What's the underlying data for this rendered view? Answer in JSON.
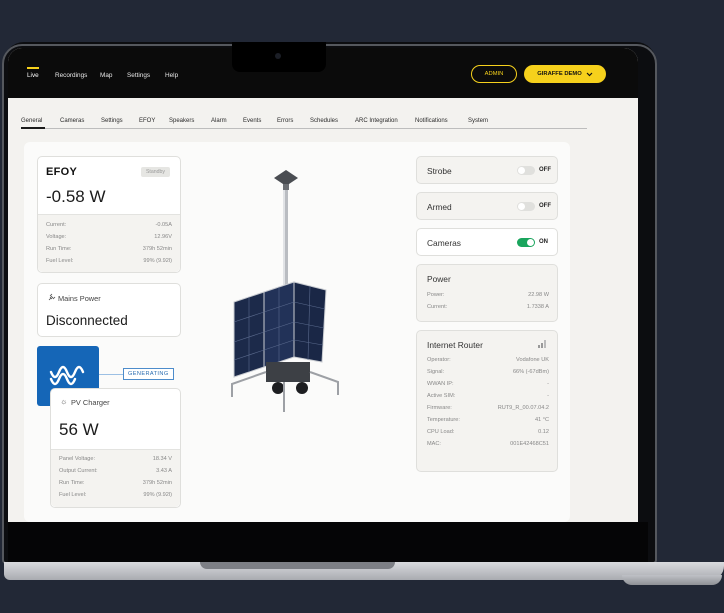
{
  "nav": {
    "items": [
      "Live",
      "Recordings",
      "Map",
      "Settings",
      "Help"
    ],
    "admin_label": "ADMIN",
    "demo_label": "GIRAFFE DEMO"
  },
  "tabs": [
    "General",
    "Cameras",
    "Settings",
    "EFOY",
    "Speakers",
    "Alarm",
    "Events",
    "Errors",
    "Schedules",
    "ARC Integration",
    "Notifications",
    "System"
  ],
  "efoy": {
    "logo": "EFOY",
    "status": "Standby",
    "power": "-0.58 W",
    "rows": [
      {
        "label": "Current:",
        "value": "-0.05A"
      },
      {
        "label": "Voltage:",
        "value": "12.96V"
      },
      {
        "label": "Run Time:",
        "value": "379h 52min"
      },
      {
        "label": "Fuel Level:",
        "value": "99% (9.92l)"
      }
    ]
  },
  "mains": {
    "title": "Mains Power",
    "status": "Disconnected"
  },
  "generating_label": "GENERATING",
  "pv": {
    "title": "PV Charger",
    "power": "56 W",
    "rows": [
      {
        "label": "Panel Voltage:",
        "value": "18.34 V"
      },
      {
        "label": "Output Current:",
        "value": "3.43 A"
      },
      {
        "label": "Run Time:",
        "value": "379h 52min"
      },
      {
        "label": "Fuel Level:",
        "value": "99% (9.92l)"
      }
    ]
  },
  "toggles": {
    "strobe": {
      "label": "Strobe",
      "state": "OFF"
    },
    "armed": {
      "label": "Armed",
      "state": "OFF"
    },
    "cameras": {
      "label": "Cameras",
      "state": "ON"
    }
  },
  "power": {
    "title": "Power",
    "rows": [
      {
        "label": "Power:",
        "value": "22.98 W"
      },
      {
        "label": "Current:",
        "value": "1.7338 A"
      }
    ]
  },
  "router": {
    "title": "Internet Router",
    "rows": [
      {
        "label": "Operator:",
        "value": "Vodafone UK"
      },
      {
        "label": "Signal:",
        "value": "66% (-67dBm)"
      },
      {
        "label": "WWAN IP:",
        "value": "-"
      },
      {
        "label": "Active SIM:",
        "value": "-"
      },
      {
        "label": "Firmware:",
        "value": "RUT9_R_00.07.04.2"
      },
      {
        "label": "Temperature:",
        "value": "41 °C"
      },
      {
        "label": "CPU Load:",
        "value": "0.12"
      },
      {
        "label": "MAC:",
        "value": "001E42468C51"
      }
    ]
  },
  "colors": {
    "accent": "#f6d11c",
    "toggle_on": "#1aa55d",
    "victron_blue": "#1566b7"
  }
}
